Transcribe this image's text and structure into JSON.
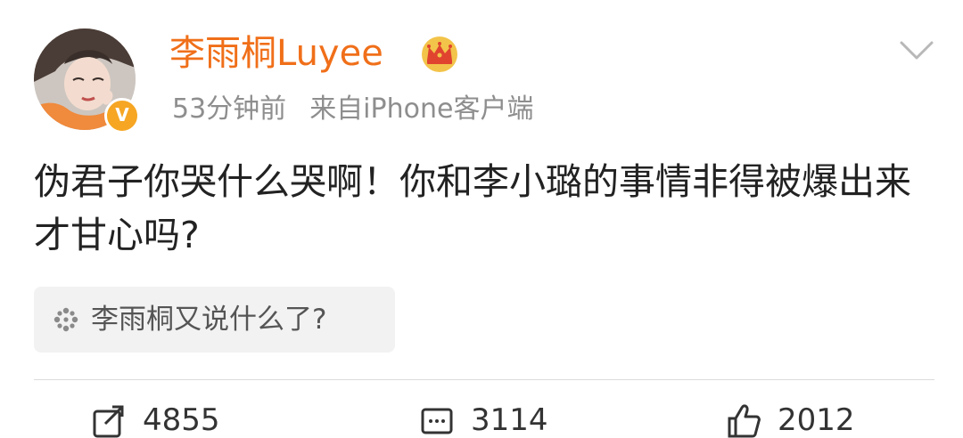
{
  "post": {
    "author": {
      "name": "李雨桐Luyee",
      "verified_mark": "V"
    },
    "time": "53分钟前",
    "source": "来自iPhone客户端",
    "text": "伪君子你哭什么哭啊！你和李小璐的事情非得被爆出来才甘心吗?",
    "topic": {
      "label": "李雨桐又说什么了?"
    },
    "actions": {
      "reposts": "4855",
      "comments": "3114",
      "likes": "2012"
    }
  },
  "icons": {
    "author_badge": "crown-icon",
    "menu": "chevron-down-icon",
    "topic": "sparkle-icon",
    "repost": "repost-icon",
    "comment": "comment-icon",
    "like": "thumbs-up-icon"
  },
  "colors": {
    "username": "#f06f19",
    "verified_badge": "#f6a623",
    "meta_text": "#8e8e8e",
    "body_text": "#222222",
    "topic_background": "#f2f2f2"
  }
}
